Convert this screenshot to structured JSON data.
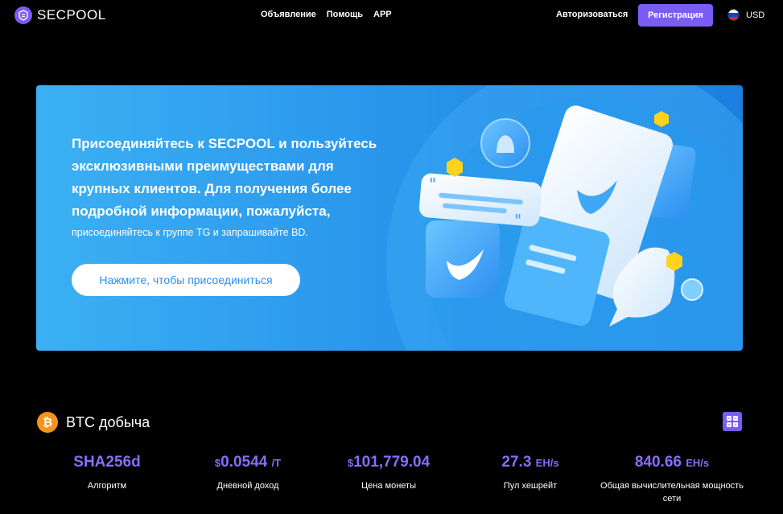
{
  "brand": {
    "name": "SECPOOL"
  },
  "nav": [
    "Объявление",
    "Помощь",
    "APP"
  ],
  "auth": {
    "login": "Авторизоваться",
    "register": "Регистрация"
  },
  "currency": "USD",
  "banner": {
    "title": "Присоединяйтесь к SECPOOL и пользуйтесь эксклюзивными преимуществами для крупных клиентов. Для получения более подробной информации, пожалуйста,",
    "subtitle": "присоединяйтесь к группе TG и запрашивайте BD.",
    "button": "Нажмите, чтобы присоединиться"
  },
  "section": {
    "title": "BTC добыча",
    "coin_icon": "bitcoin-icon",
    "tool_icon": "calculator-icon"
  },
  "stats": [
    {
      "prefix": "",
      "value": "SHA256d",
      "unit": "",
      "label": "Алгоритм"
    },
    {
      "prefix": "$",
      "value": "0.0544",
      "unit": "/T",
      "label": "Дневной доход"
    },
    {
      "prefix": "$",
      "value": "101,779.04",
      "unit": "",
      "label": "Цена монеты"
    },
    {
      "prefix": "",
      "value": "27.3",
      "unit": "EH/s",
      "label": "Пул хешрейт"
    },
    {
      "prefix": "",
      "value": "840.66",
      "unit": "EH/s",
      "label": "Общая вычислительная мощность сети"
    }
  ],
  "colors": {
    "accent": "#7b5cf5",
    "banner_blue": "#2a98ec",
    "btc_orange": "#f7931a"
  }
}
